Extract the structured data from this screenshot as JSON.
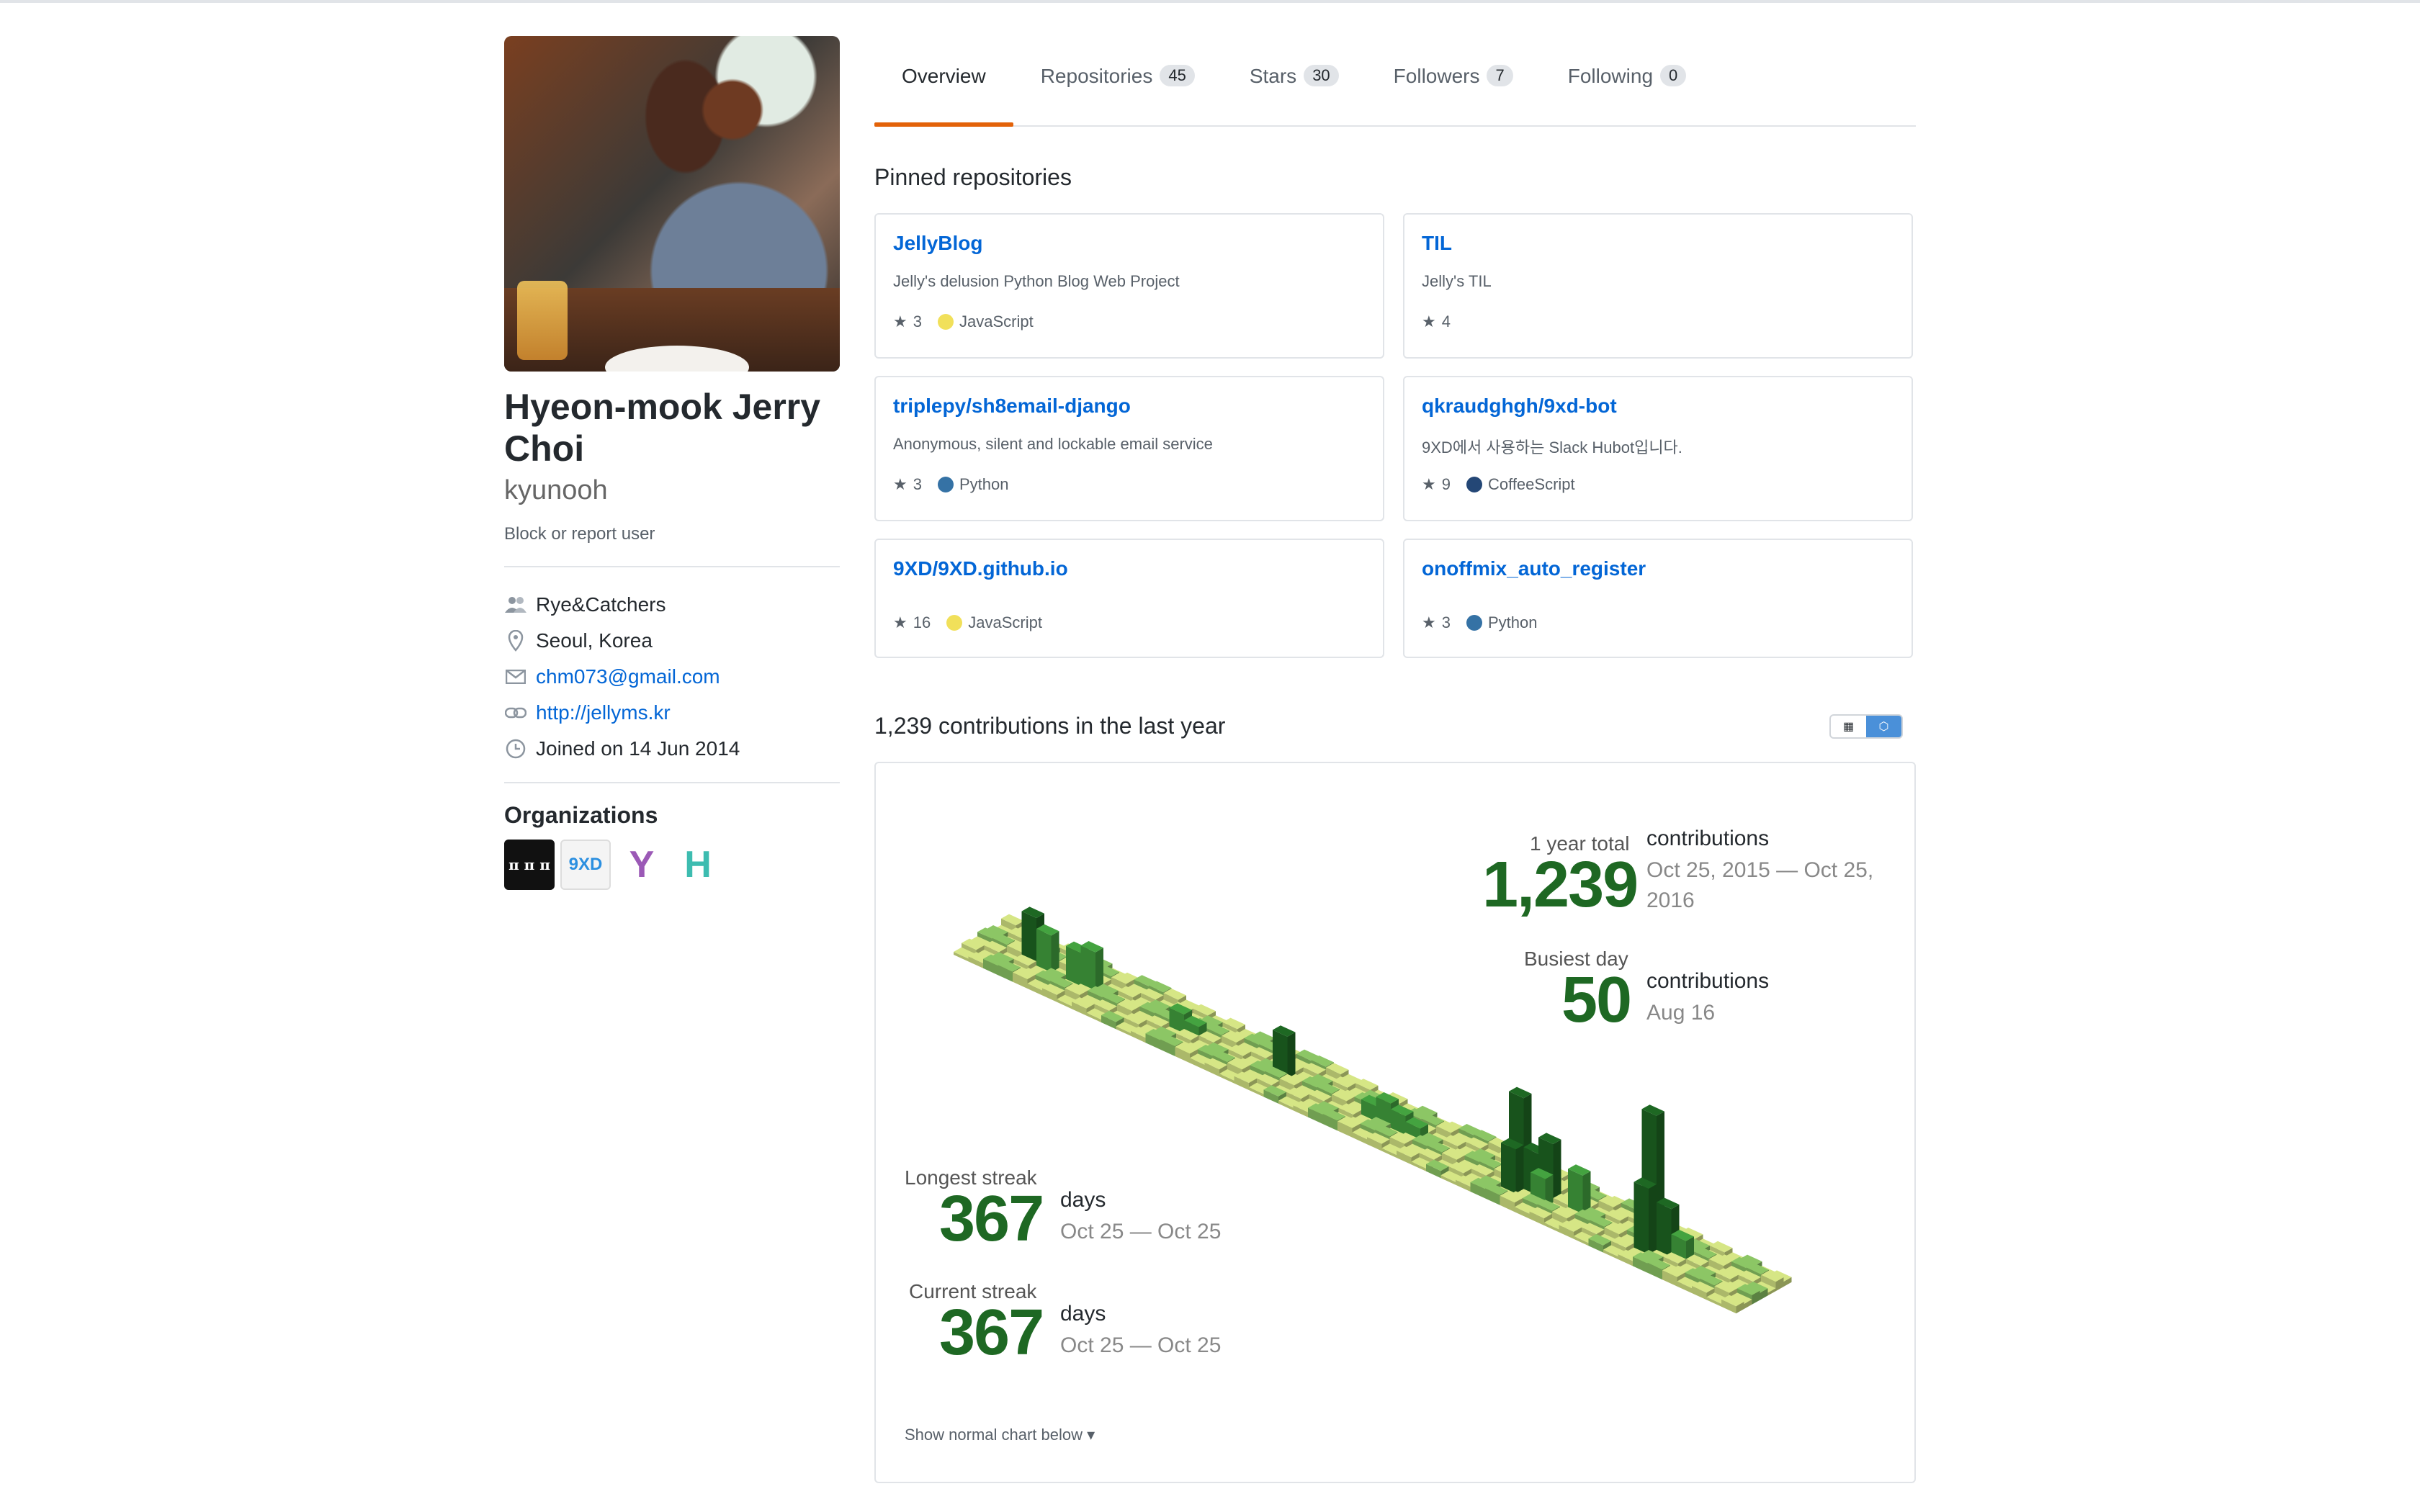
{
  "profile": {
    "full_name": "Hyeon-mook Jerry Choi",
    "username": "kyunooh",
    "block_link": "Block or report user",
    "details": [
      {
        "icon": "people-icon",
        "text": "Rye&Catchers",
        "link": false
      },
      {
        "icon": "location-icon",
        "text": "Seoul, Korea",
        "link": false
      },
      {
        "icon": "mail-icon",
        "text": "chm073@gmail.com",
        "link": true
      },
      {
        "icon": "link-icon",
        "text": "http://jellyms.kr",
        "link": true
      },
      {
        "icon": "clock-icon",
        "text": "Joined on 14 Jun 2014",
        "link": false
      }
    ],
    "organizations_title": "Organizations",
    "organizations": [
      {
        "name": "pi-org",
        "label": "π π π",
        "bg": "#111111",
        "fg": "#ffffff"
      },
      {
        "name": "9xd-org",
        "label": "9XD",
        "bg": "#f4f4f4",
        "fg": "#2b8fe0"
      },
      {
        "name": "y-org",
        "label": "Y",
        "bg": "#ffffff",
        "fg": "#9b59b6"
      },
      {
        "name": "h-org",
        "label": "H",
        "bg": "#ffffff",
        "fg": "#3dbcb0"
      }
    ]
  },
  "tabs": [
    {
      "label": "Overview",
      "count": "",
      "active": true
    },
    {
      "label": "Repositories",
      "count": "45",
      "active": false
    },
    {
      "label": "Stars",
      "count": "30",
      "active": false
    },
    {
      "label": "Followers",
      "count": "7",
      "active": false
    },
    {
      "label": "Following",
      "count": "0",
      "active": false
    }
  ],
  "pinned": {
    "title": "Pinned repositories",
    "repos": [
      {
        "owner": "",
        "name": "JellyBlog",
        "desc": "Jelly's delusion Python Blog Web Project",
        "stars": "3",
        "lang": "JavaScript",
        "lang_color": "#f1e05a"
      },
      {
        "owner": "",
        "name": "TIL",
        "desc": "Jelly's TIL",
        "stars": "4",
        "lang": "",
        "lang_color": ""
      },
      {
        "owner": "triplepy/",
        "name": "sh8email-django",
        "desc": "Anonymous, silent and lockable email service",
        "stars": "3",
        "lang": "Python",
        "lang_color": "#3572A5"
      },
      {
        "owner": "qkraudghgh/",
        "name": "9xd-bot",
        "desc": "9XD에서 사용하는 Slack Hubot입니다.",
        "stars": "9",
        "lang": "CoffeeScript",
        "lang_color": "#244776"
      },
      {
        "owner": "9XD/",
        "name": "9XD.github.io",
        "desc": "",
        "stars": "16",
        "lang": "JavaScript",
        "lang_color": "#f1e05a"
      },
      {
        "owner": "",
        "name": "onoffmix_auto_register",
        "desc": "",
        "stars": "3",
        "lang": "Python",
        "lang_color": "#3572A5"
      }
    ]
  },
  "contributions": {
    "title": "1,239 contributions in the last year",
    "year_total_label": "1 year total",
    "year_total": "1,239",
    "year_total_unit": "contributions",
    "year_total_range_1": "Oct 25, 2015 — Oct 25,",
    "year_total_range_2": "2016",
    "busiest_label": "Busiest day",
    "busiest": "50",
    "busiest_unit": "contributions",
    "busiest_date": "Aug 16",
    "longest_label": "Longest streak",
    "longest": "367",
    "longest_unit": "days",
    "longest_range": "Oct 25 — Oct 25",
    "current_label": "Current streak",
    "current": "367",
    "current_unit": "days",
    "current_range": "Oct 25 — Oct 25",
    "show_normal": "Show normal chart below ▾",
    "colors": {
      "light": "#d6e685",
      "mid": "#8cc665",
      "dark": "#44a340",
      "darkest": "#1e6823"
    }
  }
}
